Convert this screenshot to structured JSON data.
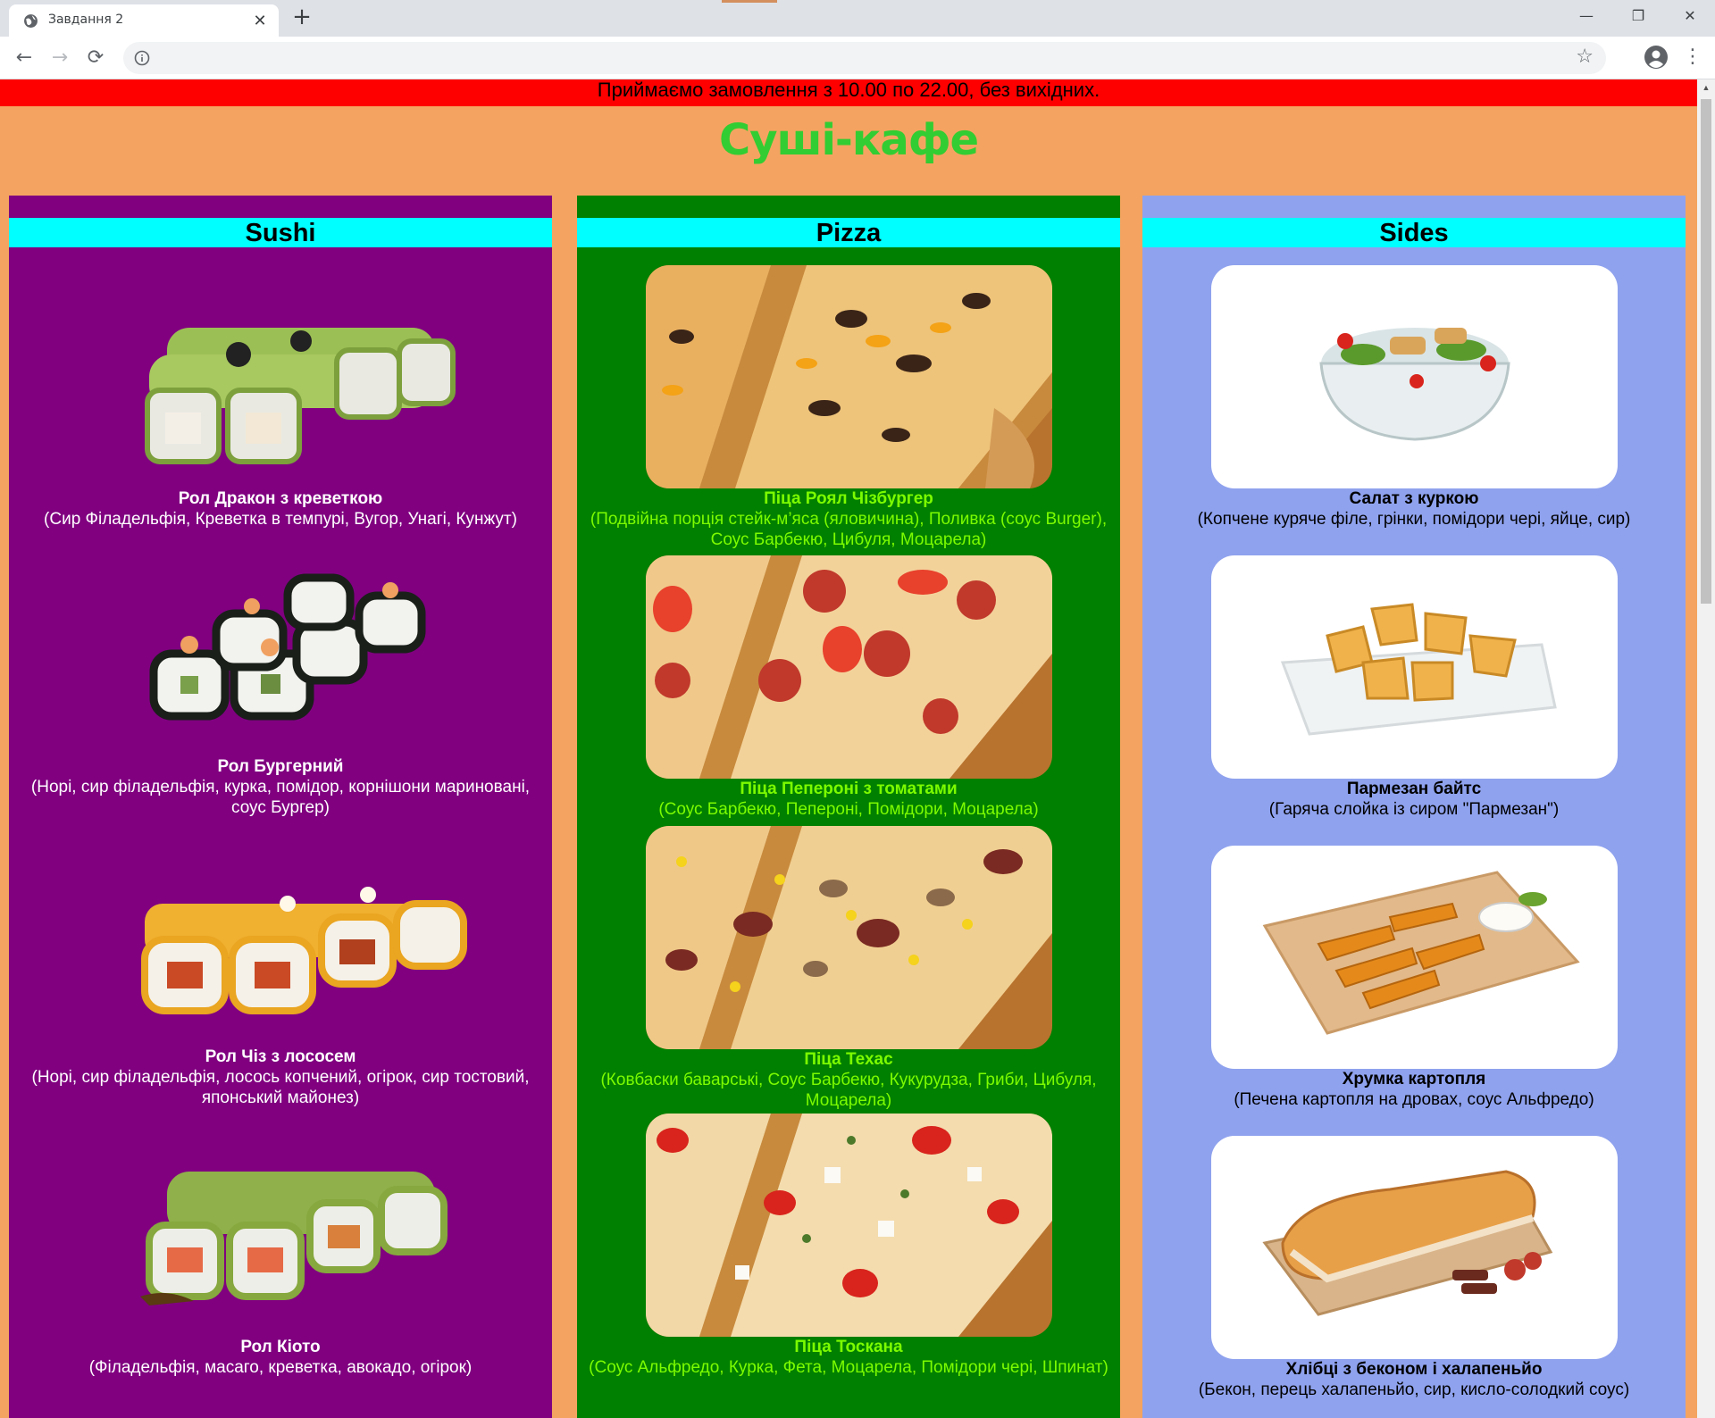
{
  "browser": {
    "tab_title": "Завдання 2",
    "tab_close": "✕",
    "new_tab": "+",
    "window": {
      "minimize": "—",
      "restore": "❐",
      "close": "✕"
    },
    "nav": {
      "back": "←",
      "forward": "→",
      "reload": "⟳"
    },
    "address_value": "",
    "star": "☆",
    "menu": "⋮",
    "icons": [
      "globe-icon",
      "close-icon",
      "plus-icon",
      "back-arrow-icon",
      "forward-arrow-icon",
      "reload-icon",
      "info-icon",
      "star-icon",
      "profile-icon",
      "menu-icon"
    ]
  },
  "page": {
    "notice": "Приймаємо замовлення з 10.00 по 22.00, без вихідних.",
    "title": "Суші-кафе",
    "colors": {
      "page_bg": "#f4a460",
      "notice_bg": "#ff0000",
      "title": "#32cd32",
      "header_bg": "#00ffff",
      "sushi_bg": "#800080",
      "pizza_bg": "#008000",
      "sides_bg": "#8fa2ee",
      "pizza_text": "#7cfc00"
    }
  },
  "menu": {
    "sushi": {
      "heading": "Sushi",
      "items": [
        {
          "name": "Рол Дракон з креветкою",
          "desc": "(Сир Філадельфія, Креветка в темпурі, Вугор, Унагі, Кунжут)",
          "image": "sushi-dragon-roll"
        },
        {
          "name": "Рол Бургерний",
          "desc": "(Норі, сир філадельфія, курка, помідор, корнішони мариновані, соус Бургер)",
          "image": "sushi-burger-roll"
        },
        {
          "name": "Рол Чіз з лососем",
          "desc": "(Норі, сир філадельфія, лосось копчений, огірок, сир тостовий, японський майонез)",
          "image": "sushi-cheese-salmon-roll"
        },
        {
          "name": "Рол Кіото",
          "desc": "(Філадельфія, масаго, креветка, авокадо, огірок)",
          "image": "sushi-kyoto-roll"
        }
      ]
    },
    "pizza": {
      "heading": "Pizza",
      "items": [
        {
          "name": "Піца Роял Чізбургер",
          "desc": "(Подвійна порція стейк-м’яса (яловичина), Поливка (соус Burger), Соус Барбекю, Цибуля, Моцарела)",
          "image": "pizza-royal-cheeseburger"
        },
        {
          "name": "Піца Пепероні з томатами",
          "desc": "(Соус Барбекю, Пепероні, Помідори, Моцарела)",
          "image": "pizza-pepperoni-tomato"
        },
        {
          "name": "Піца Техас",
          "desc": "(Ковбаски баварські, Соус Барбекю, Кукурудза, Гриби, Цибуля, Моцарела)",
          "image": "pizza-texas"
        },
        {
          "name": "Піца Тоскана",
          "desc": "(Соус Альфредо, Курка, Фета, Моцарела, Помідори чері, Шпинат)",
          "image": "pizza-toscana"
        }
      ]
    },
    "sides": {
      "heading": "Sides",
      "items": [
        {
          "name": "Салат з куркою",
          "desc": "(Копчене куряче філе, грінки, помідори чері, яйце, сир)",
          "image": "chicken-salad-bowl"
        },
        {
          "name": "Пармезан байтс",
          "desc": "(Гаряча слойка із сиром \"Пармезан\")",
          "image": "parmesan-bites-plate"
        },
        {
          "name": "Хрумка картопля",
          "desc": "(Печена картопля на дровах, соус Альфредо)",
          "image": "potato-wedges-board"
        },
        {
          "name": "Хлібці з беконом і халапеньйо",
          "desc": "(Бекон, перець халапеньйо, сир, кисло-солодкий соус)",
          "image": "bacon-jalapeno-bread-board"
        }
      ]
    }
  }
}
